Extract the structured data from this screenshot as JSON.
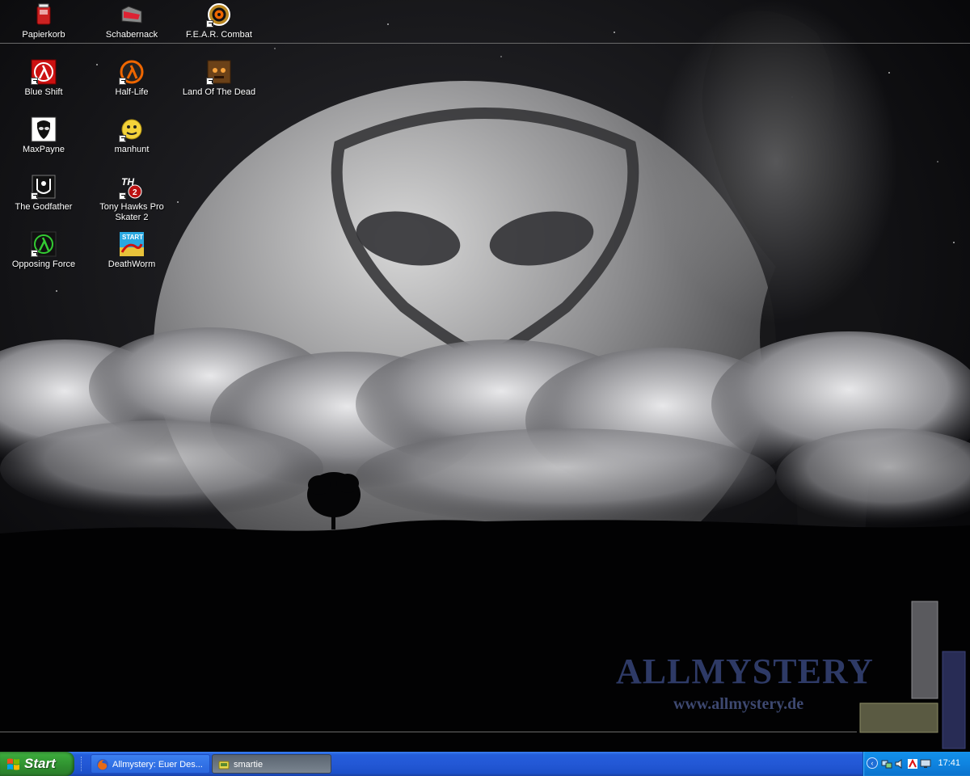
{
  "desktop": {
    "icons": [
      {
        "label": "Papierkorb",
        "icon": "recycle-bin-icon"
      },
      {
        "label": "Schabernack",
        "icon": "folder-icon"
      },
      {
        "label": "F.E.A.R. Combat",
        "icon": "fear-icon"
      },
      {
        "label": "Blue Shift",
        "icon": "halflife-blue-shift-icon"
      },
      {
        "label": "Half-Life",
        "icon": "halflife-icon"
      },
      {
        "label": "Land Of The Dead",
        "icon": "land-of-the-dead-icon"
      },
      {
        "label": "MaxPayne",
        "icon": "max-payne-icon"
      },
      {
        "label": "manhunt",
        "icon": "manhunt-icon"
      },
      {
        "label": "The Godfather",
        "icon": "godfather-icon"
      },
      {
        "label": "Tony Hawks Pro Skater 2",
        "icon": "tony-hawk-icon"
      },
      {
        "label": "Opposing Force",
        "icon": "opposing-force-icon"
      },
      {
        "label": "DeathWorm",
        "icon": "deathworm-icon"
      }
    ]
  },
  "wallpaper": {
    "brand": "ALLMYSTERY",
    "url": "www.allmystery.de",
    "brand_color": "#2e3a66"
  },
  "taskbar": {
    "start_label": "Start",
    "tasks": [
      {
        "label": "Allmystery: Euer Des...",
        "icon": "firefox-icon",
        "active": false
      },
      {
        "label": "smartie",
        "icon": "smartie-icon",
        "active": true
      }
    ],
    "clock": "17:41",
    "tray_icons": [
      "chevron-left-icon",
      "network-icon",
      "volume-icon",
      "antivirus-icon",
      "display-icon"
    ]
  }
}
